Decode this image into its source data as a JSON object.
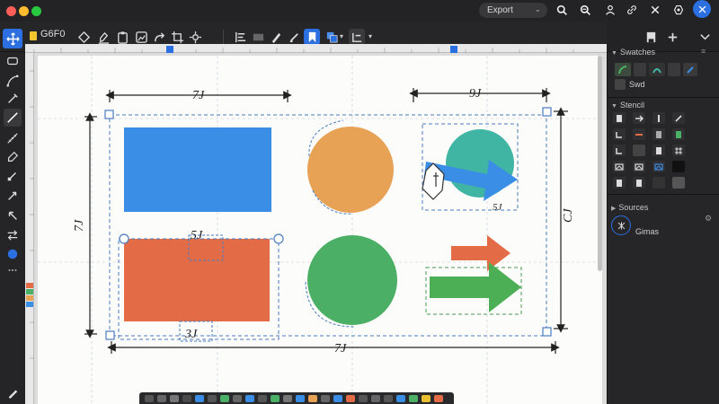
{
  "window": {
    "search_label": "Export",
    "colors": {
      "close": "#ff5f57",
      "minimize": "#febc2e",
      "zoom": "#28c840"
    }
  },
  "toolbar": {
    "document_name": "G6F0"
  },
  "panel": {
    "section1_title": "Swatches",
    "swatch_label": "Swd",
    "section2_title": "Stencil",
    "section3_title": "Sources",
    "section3_item": "Gimas"
  },
  "canvas": {
    "dimensions": {
      "top_left": "7J",
      "top_right": "9J",
      "left": "7J",
      "right": "CJ",
      "bottom": "7J",
      "inner_top": "5J",
      "inner_bottom": "3J",
      "arrow_label": "5J"
    },
    "shape_colors": {
      "blue_rect": "#3b8ee6",
      "orange_circle": "#e8a255",
      "teal_circle": "#40b5a4",
      "blue_arrow": "#3b8ee6",
      "orange_rect": "#e36b45",
      "green_circle": "#4caf66",
      "orange_arrow": "#e36b45",
      "green_arrow": "#4caf55"
    }
  }
}
